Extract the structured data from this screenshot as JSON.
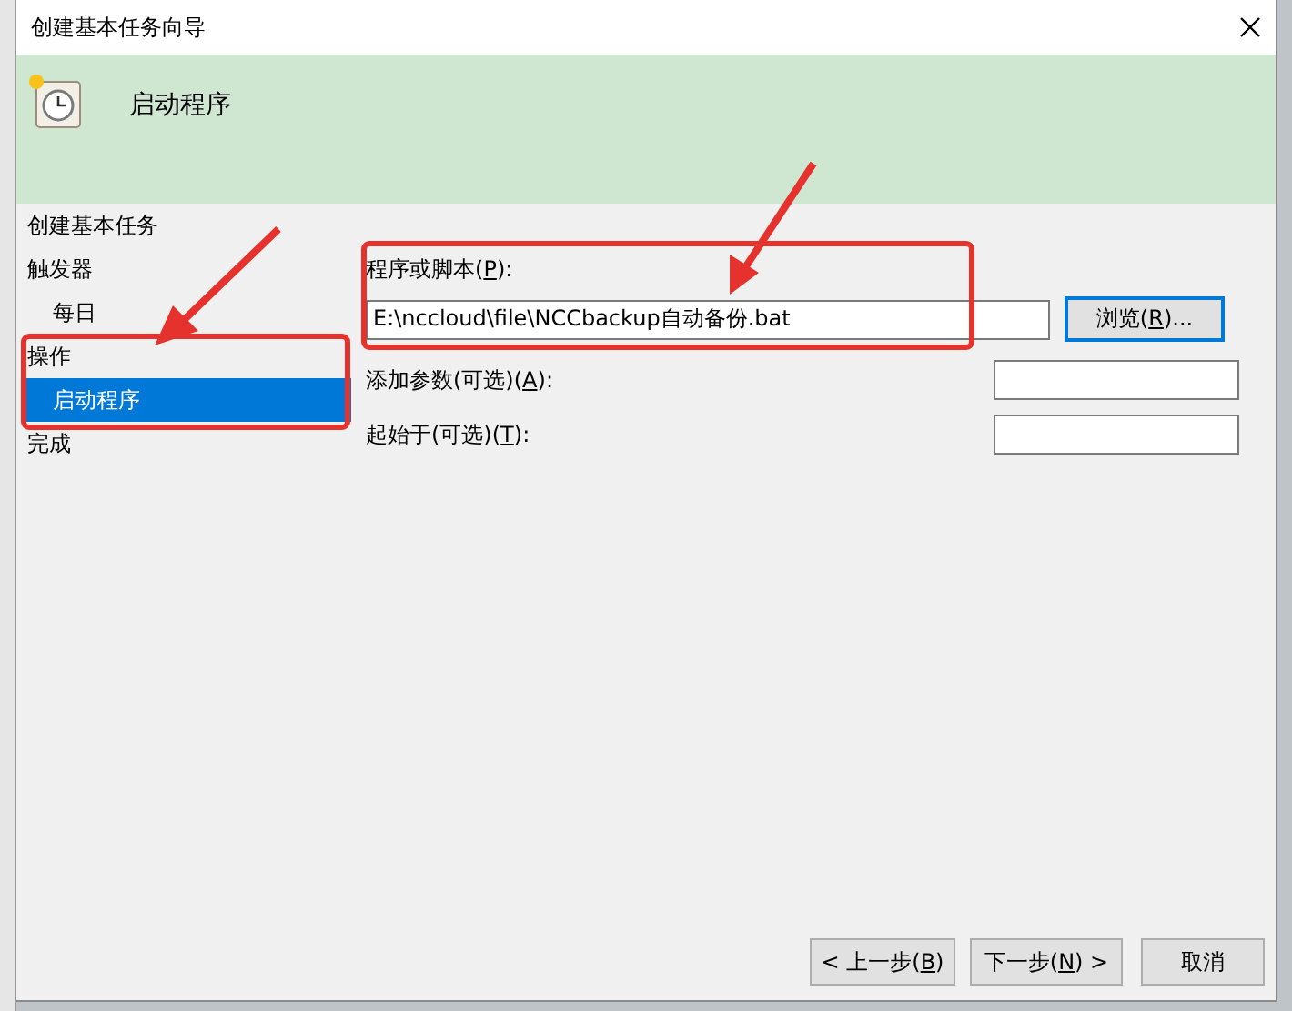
{
  "window": {
    "title": "创建基本任务向导"
  },
  "header": {
    "title": "启动程序"
  },
  "steps": [
    {
      "label": "创建基本任务",
      "selected": false
    },
    {
      "label": "触发器",
      "selected": false,
      "children": [
        {
          "label": "每日",
          "selected": false
        }
      ]
    },
    {
      "label": "操作",
      "selected": false,
      "children": [
        {
          "label": "启动程序",
          "selected": true
        }
      ]
    },
    {
      "label": "完成",
      "selected": false
    }
  ],
  "fields": [
    {
      "kind": "wide",
      "label": {
        "before": "程序或脚本(",
        "key": "P",
        "after": "):"
      },
      "value": "E:\\nccloud\\file\\NCCbackup自动备份.bat",
      "button": {
        "before": "浏览(",
        "key": "R",
        "after": ")..."
      }
    },
    {
      "kind": "short",
      "label": {
        "before": "添加参数(可选)(",
        "key": "A",
        "after": "):"
      }
    },
    {
      "kind": "short",
      "label": {
        "before": "起始于(可选)(",
        "key": "T",
        "after": "):"
      }
    }
  ],
  "buttons": [
    {
      "before": "< 上一步(",
      "key": "B",
      "after": ")"
    },
    {
      "before": "下一步(",
      "key": "N",
      "after": ") >"
    },
    {
      "before": "取消"
    }
  ]
}
